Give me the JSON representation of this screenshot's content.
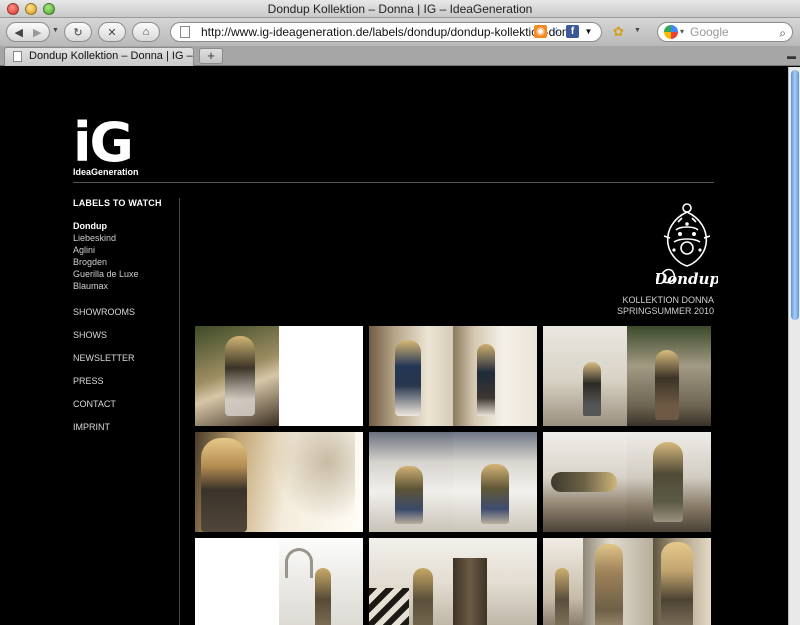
{
  "window": {
    "title": "Dondup Kollektion – Donna | IG – IdeaGeneration"
  },
  "toolbar": {
    "url": "http://www.ig-ideageneration.de/labels/dondup/dondup-kollektion-don",
    "search_placeholder": "Google"
  },
  "tabs": [
    {
      "label": "Dondup Kollektion – Donna | IG – ..."
    }
  ],
  "site": {
    "logo_mark": "iG",
    "logo_text": "IdeaGeneration",
    "nav_heading": "LABELS TO WATCH",
    "labels": [
      "Dondup",
      "Liebeskind",
      "Aglini",
      "Brogden",
      "Guerilla de Luxe",
      "Blaumax"
    ],
    "links": [
      "SHOWROOMS",
      "SHOWS",
      "NEWSLETTER",
      "PRESS",
      "CONTACT",
      "IMPRINT"
    ],
    "brand_name": "Dondup",
    "caption_line1": "KOLLEKTION DONNA",
    "caption_line2": "SPRINGSUMMER 2010"
  },
  "colors": {
    "background": "#000000",
    "text": "#ffffff",
    "muted": "#cfcfcf",
    "scroll_thumb": "#6fa4e2"
  }
}
